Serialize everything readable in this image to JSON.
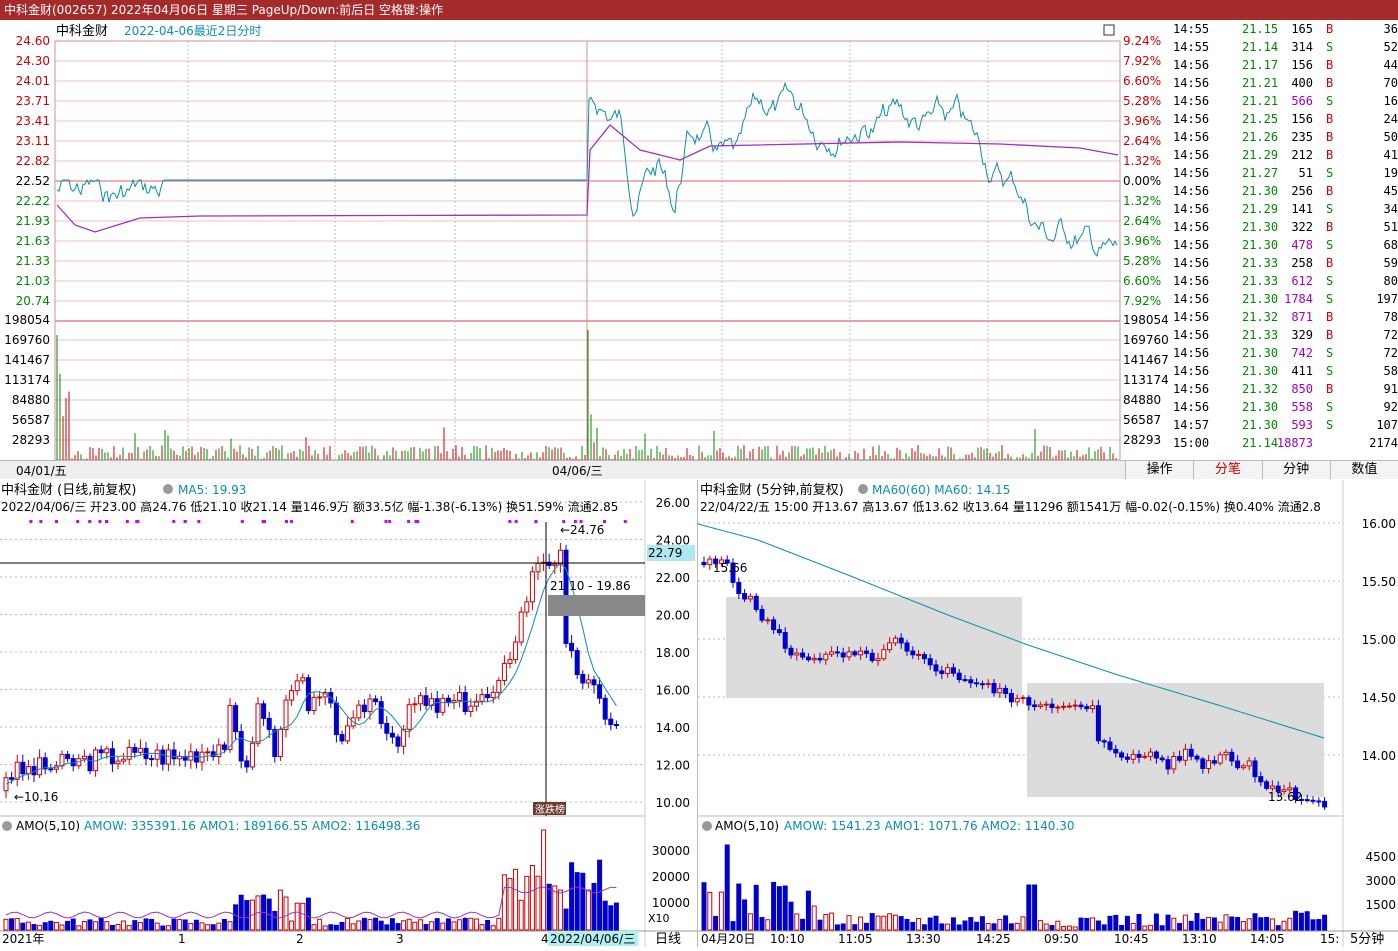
{
  "title_bar": "中科金财(002657) 2022年04月06日 星期三 PageUp/Down:前后日 空格键:操作",
  "intraday": {
    "stock_name": "中科金财",
    "subtitle": "2022-04-06最近2日分时",
    "price_labels": [
      "24.60",
      "24.30",
      "24.01",
      "23.71",
      "23.41",
      "23.11",
      "22.82",
      "22.52",
      "22.22",
      "21.93",
      "21.63",
      "21.33",
      "21.03",
      "20.74"
    ],
    "pct_labels": [
      "9.24%",
      "7.92%",
      "6.60%",
      "5.28%",
      "3.96%",
      "2.64%",
      "1.32%",
      "0.00%",
      "1.32%",
      "2.64%",
      "3.96%",
      "5.28%",
      "6.60%",
      "7.92%"
    ],
    "vol_labels": [
      "198054",
      "169760",
      "141467",
      "113174",
      "84880",
      "56587",
      "28293"
    ],
    "date_labels": [
      "04/01/五",
      "04/06/三"
    ]
  },
  "ticks": [
    [
      "14:55",
      "21.15",
      "165",
      "B",
      "36"
    ],
    [
      "14:55",
      "21.14",
      "314",
      "S",
      "52"
    ],
    [
      "14:56",
      "21.17",
      "156",
      "B",
      "44"
    ],
    [
      "14:56",
      "21.21",
      "400",
      "B",
      "70"
    ],
    [
      "14:56",
      "21.21",
      "566",
      "S",
      "16"
    ],
    [
      "14:56",
      "21.25",
      "156",
      "B",
      "24"
    ],
    [
      "14:56",
      "21.26",
      "235",
      "B",
      "50"
    ],
    [
      "14:56",
      "21.29",
      "212",
      "B",
      "41"
    ],
    [
      "14:56",
      "21.27",
      "51",
      "S",
      "19"
    ],
    [
      "14:56",
      "21.30",
      "256",
      "B",
      "45"
    ],
    [
      "14:56",
      "21.29",
      "141",
      "S",
      "34"
    ],
    [
      "14:56",
      "21.30",
      "322",
      "B",
      "51"
    ],
    [
      "14:56",
      "21.30",
      "478",
      "S",
      "68"
    ],
    [
      "14:56",
      "21.33",
      "258",
      "B",
      "59"
    ],
    [
      "14:56",
      "21.33",
      "612",
      "S",
      "80"
    ],
    [
      "14:56",
      "21.30",
      "1784",
      "S",
      "197"
    ],
    [
      "14:56",
      "21.32",
      "871",
      "B",
      "78"
    ],
    [
      "14:56",
      "21.33",
      "329",
      "B",
      "72"
    ],
    [
      "14:56",
      "21.30",
      "742",
      "S",
      "72"
    ],
    [
      "14:56",
      "21.30",
      "411",
      "S",
      "58"
    ],
    [
      "14:56",
      "21.32",
      "850",
      "B",
      "91"
    ],
    [
      "14:56",
      "21.30",
      "558",
      "S",
      "92"
    ],
    [
      "14:57",
      "21.30",
      "593",
      "S",
      "107"
    ],
    [
      "15:00",
      "21.14",
      "18873",
      "",
      "2174"
    ]
  ],
  "tabs": [
    "操作",
    "分笔",
    "分钟",
    "数值"
  ],
  "daily": {
    "title": "中科金财 (日线,前复权)",
    "ma": "MA5: 19.93",
    "info": "2022/04/06/三 开23.00 高24.76 低21.10 收21.14 量146.9万 额33.5亿 幅-1.38(-6.13%) 换51.59% 流通2.85",
    "y_labels": [
      "26.00",
      "24.00",
      "22.00",
      "20.00",
      "18.00",
      "16.00",
      "14.00",
      "12.00",
      "10.00"
    ],
    "cursor_price": "22.79",
    "high_label": "24.76",
    "range_label": "21.10 - 19.86",
    "low_label": "10.16",
    "badge": "涨跌榜",
    "amo_title": "AMO(5,10)",
    "amo_vals": "AMOW: 335391.16 AMO1: 189166.55 AMO2: 116498.36",
    "amo_y": [
      "30000",
      "20000",
      "10000"
    ],
    "amo_unit": "X10",
    "x_labels": [
      "2021年",
      "1",
      "2",
      "3",
      "4"
    ],
    "cursor_date": "2022/04/06/三",
    "period_label": "日线"
  },
  "min5": {
    "title": "中科金财 (5分钟,前复权)",
    "ma": "MA60(60) MA60: 14.15",
    "info": "22/04/22/五 15:00 开13.67 高13.67 低13.62 收13.64 量11296 额1541万 幅-0.02(-0.15%) 换0.40% 流通2.8",
    "y_labels": [
      "16.00",
      "15.50",
      "15.00",
      "14.50",
      "14.00"
    ],
    "high_label": "15.66",
    "low_label": "13.62",
    "amo_title": "AMO(5,10)",
    "amo_vals": "AMOW: 1541.23 AMO1: 1071.76 AMO2: 1140.30",
    "amo_y": [
      "4500",
      "3000",
      "1500"
    ],
    "x_labels": [
      "04月20日",
      "10:10",
      "11:05",
      "13:30",
      "14:25",
      "09:50",
      "10:45",
      "13:10",
      "14:05",
      "15:"
    ],
    "period_label": "5分钟"
  }
}
